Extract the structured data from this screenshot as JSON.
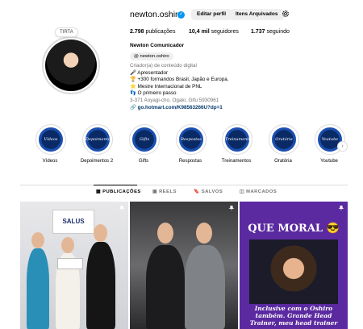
{
  "profile": {
    "username": "newton.oshiro",
    "avatar_note": "TIRTA",
    "edit_button": "Editar perfil",
    "archive_button": "Itens Arquivados",
    "settings_icon": "gear-icon",
    "verified_icon": "verified-badge-icon",
    "stats": {
      "posts_count": "2.798",
      "posts_label": "publicações",
      "followers_count": "10,4 mil",
      "followers_label": "seguidores",
      "following_count": "1.737",
      "following_label": "seguindo"
    },
    "name": "Newton Comunicador",
    "threads_handle": "newton.oshiro",
    "bio": {
      "category": "Criador(a) de conteúdo digital",
      "line1": "🎤 Apresentador",
      "line2": "🏆 +300 formandos Brasil, Japão e Europa.",
      "line3": "⭐ Mestre Internacional de PNL",
      "line4": "👣 O primeiro passo",
      "address": "3-371 Aoyagi-cho, Ogaki, Gifu 5930961",
      "link": "go.hotmart.com/K98563266U?dp=1"
    }
  },
  "highlights": [
    {
      "cover": "Vídeos",
      "label": "Vídeos"
    },
    {
      "cover": "Depoimentos 2",
      "label": "Depoimentos 2"
    },
    {
      "cover": "Gifts",
      "label": "Gifts"
    },
    {
      "cover": "Respostas",
      "label": "Respostas"
    },
    {
      "cover": "Treinamentos",
      "label": "Treinamentos"
    },
    {
      "cover": "Oratória",
      "label": "Oratória"
    },
    {
      "cover": "Youtube",
      "label": "Youtube"
    }
  ],
  "tabs": {
    "posts": "PUBLICAÇÕES",
    "reels": "REELS",
    "saved": "SALVOS",
    "tagged": "MARCADOS"
  },
  "posts": {
    "post1_sign": "SALUS",
    "post3_title": "QUE MORAL 😎",
    "post3_caption": "Inclusive com o Oshiro também. Grande Head Trainer, meu head trainer"
  },
  "colors": {
    "accent": "#0095f6",
    "link": "#00376b",
    "highlight_cover": "#0a2a66",
    "post3_bg": "#5b2aa0"
  }
}
